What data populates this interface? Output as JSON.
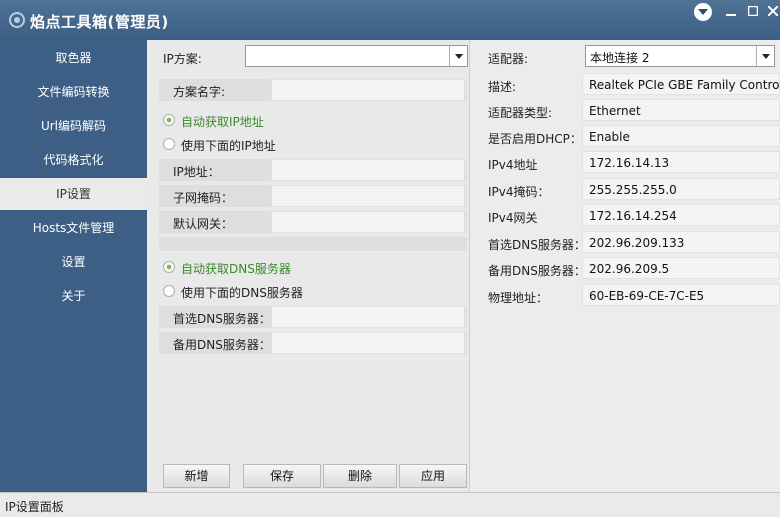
{
  "app": {
    "title": "焰点工具箱(管理员)"
  },
  "sidebar": {
    "items": [
      {
        "label": "取色器"
      },
      {
        "label": "文件编码转换"
      },
      {
        "label": "Url编码解码"
      },
      {
        "label": "代码格式化"
      },
      {
        "label": "IP设置"
      },
      {
        "label": "Hosts文件管理"
      },
      {
        "label": "设置"
      },
      {
        "label": "关于"
      }
    ],
    "active_index": 4
  },
  "left": {
    "ip_scheme_label": "IP方案:",
    "ip_scheme_value": "",
    "scheme_name_label": "方案名字:",
    "auto_ip_label": "自动获取IP地址",
    "manual_ip_label": "使用下面的IP地址",
    "ip_address_label": "IP地址：",
    "subnet_label": "子网掩码：",
    "gateway_label": "默认网关：",
    "auto_dns_label": "自动获取DNS服务器",
    "manual_dns_label": "使用下面的DNS服务器",
    "preferred_dns_label": "首选DNS服务器：",
    "alternate_dns_label": "备用DNS服务器：",
    "buttons": {
      "add": "新增",
      "save": "保存",
      "delete": "删除",
      "apply": "应用"
    }
  },
  "right": {
    "adapter_label": "适配器:",
    "adapter_value": "本地连接 2",
    "rows": [
      {
        "label": "描述:",
        "value": "Realtek PCIe GBE Family Controll"
      },
      {
        "label": "适配器类型:",
        "value": "Ethernet"
      },
      {
        "label": "是否启用DHCP：",
        "value": "Enable"
      },
      {
        "label": "IPv4地址",
        "value": "172.16.14.13"
      },
      {
        "label": "IPv4掩码：",
        "value": "255.255.255.0"
      },
      {
        "label": "IPv4网关",
        "value": "172.16.14.254"
      },
      {
        "label": "首选DNS服务器：",
        "value": "202.96.209.133"
      },
      {
        "label": "备用DNS服务器：",
        "value": "202.96.209.5"
      },
      {
        "label": "物理地址：",
        "value": "60-EB-69-CE-7C-E5"
      }
    ]
  },
  "status": {
    "text": "IP设置面板"
  },
  "colors": {
    "sidebar": "#3d5f86",
    "active_nav": "#eaeaea",
    "radio_checked": "#7db843"
  }
}
